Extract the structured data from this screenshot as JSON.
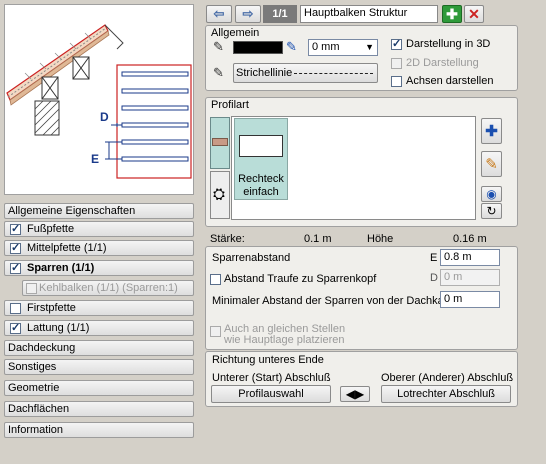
{
  "nav": {
    "page": "1/1",
    "title": "Hauptbalken Struktur"
  },
  "sidebar": {
    "items": [
      {
        "label": "Allgemeine Eigenschaften",
        "check": null
      },
      {
        "label": "Fußpfette",
        "check": true
      },
      {
        "label": "Mittelpfette (1/1)",
        "check": true
      },
      {
        "label": "Sparren (1/1)",
        "check": true,
        "bold": true
      },
      {
        "label": "Kehlbalken (1/1) (Sparren:1)",
        "check": false
      },
      {
        "label": "Firstpfette",
        "check": false
      },
      {
        "label": "Lattung (1/1)",
        "check": true
      },
      {
        "label": "Dachdeckung",
        "check": null
      },
      {
        "label": "Sonstiges",
        "check": null
      },
      {
        "label": "Geometrie",
        "check": null
      },
      {
        "label": "Dachflächen",
        "check": null
      },
      {
        "label": "Information",
        "check": null
      }
    ]
  },
  "preview": {
    "label_d": "D",
    "label_e": "E"
  },
  "allgemein": {
    "title": "Allgemein",
    "line_width": "0 mm",
    "line_style": "Strichellinie",
    "chk_3d": "Darstellung in 3D",
    "chk_2d": "2D Darstellung",
    "chk_axes": "Achsen darstellen"
  },
  "profilart": {
    "title": "Profilart",
    "profile_name": "Rechteck einfach"
  },
  "dims": {
    "staerke_label": "Stärke:",
    "staerke_value": "0.1 m",
    "hoehe_label": "Höhe",
    "hoehe_value": "0.16 m"
  },
  "spacing": {
    "sparrenabstand_label": "Sparrenabstand",
    "e_letter": "E",
    "e_value": "0.8 m",
    "traufe_label": "Abstand Traufe zu Sparrenkopf",
    "d_letter": "D",
    "d_value": "0 m",
    "min_label": "Minimaler Abstand der Sparren von der Dachkante",
    "min_value": "0 m",
    "auch_label": "Auch an gleichen Stellen wie Hauptlage platzieren"
  },
  "richtung": {
    "title": "Richtung unteres Ende",
    "start_label": "Unterer (Start) Abschluß",
    "end_label": "Oberer (Anderer) Abschluß",
    "start_button": "Profilauswahl",
    "end_button": "Lotrechter Abschluß"
  },
  "colors": {
    "accent": "#cc2222",
    "profile_sel": "#b9ddd8",
    "blue_chip": "#1a4fb0"
  }
}
